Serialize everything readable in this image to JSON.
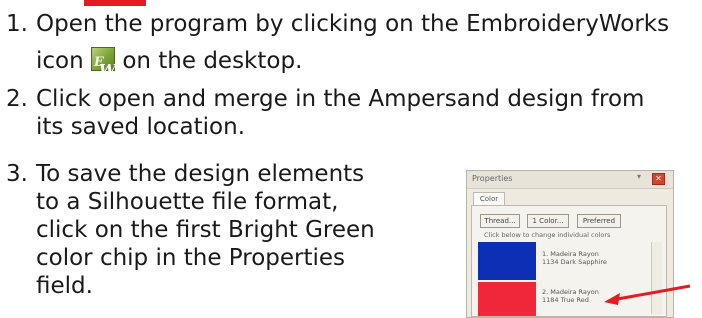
{
  "steps": [
    {
      "number": "1.",
      "line1": "Open the program by clicking on the EmbroideryWorks",
      "line2_before": "icon",
      "line2_after": "on the desktop.",
      "icon": {
        "name": "embroideryworks-icon",
        "letters": "EW"
      }
    },
    {
      "number": "2.",
      "line1": "Click open and merge in the Ampersand design from",
      "line2": "its saved location."
    },
    {
      "number": "3.",
      "lines": [
        "To save the design elements",
        "to a Silhouette file format,",
        "click on the first Bright Green",
        "color chip in the Properties",
        "field."
      ]
    }
  ],
  "properties_panel": {
    "title": "Properties",
    "tab": "Color",
    "buttons": [
      "Thread...",
      "1 Color...",
      "Preferred"
    ],
    "hint": "Click below to change individual colors",
    "chips": [
      {
        "color": "#0d2fb6",
        "label_line1": "1. Madeira Rayon",
        "label_line2": "1134 Dark Sapphire"
      },
      {
        "color": "#f0273a",
        "label_line1": "2. Madeira Rayon",
        "label_line2": "1184 True Red"
      }
    ]
  },
  "colors": {
    "accent": "#e31b23",
    "arrow": "#e31b23"
  }
}
